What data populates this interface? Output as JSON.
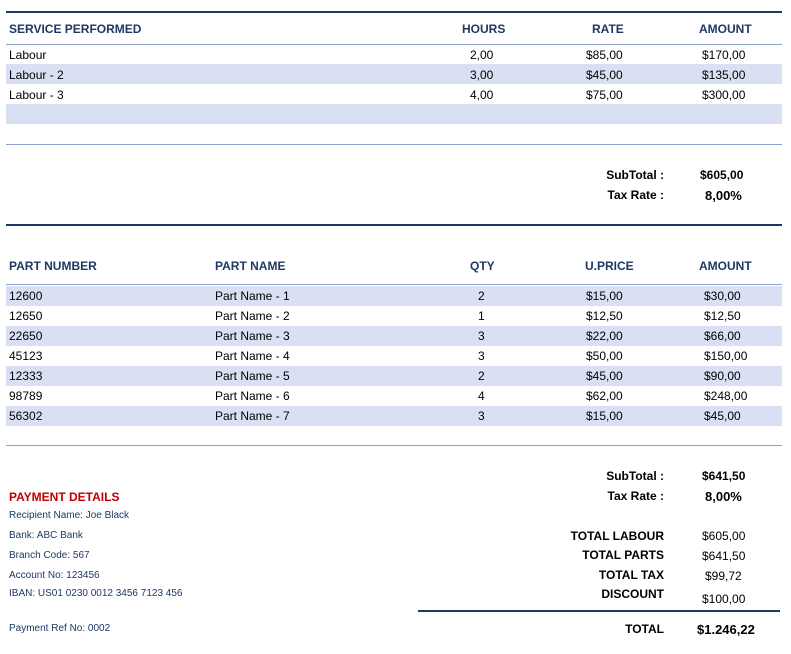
{
  "services": {
    "headers": {
      "service": "SERVICE PERFORMED",
      "hours": "HOURS",
      "rate": "RATE",
      "amount": "AMOUNT"
    },
    "rows": [
      {
        "service": "Labour",
        "hours": "2,00",
        "rate": "$85,00",
        "amount": "$170,00"
      },
      {
        "service": "Labour - 2",
        "hours": "3,00",
        "rate": "$45,00",
        "amount": "$135,00"
      },
      {
        "service": "Labour - 3",
        "hours": "4,00",
        "rate": "$75,00",
        "amount": "$300,00"
      }
    ],
    "subtotal_label": "SubTotal :",
    "subtotal_value": "$605,00",
    "taxrate_label": "Tax Rate :",
    "taxrate_value": "8,00%"
  },
  "parts": {
    "headers": {
      "number": "PART NUMBER",
      "name": "PART NAME",
      "qty": "QTY",
      "uprice": "U.PRICE",
      "amount": "AMOUNT"
    },
    "rows": [
      {
        "number": "12600",
        "name": "Part Name - 1",
        "qty": "2",
        "uprice": "$15,00",
        "amount": "$30,00"
      },
      {
        "number": "12650",
        "name": "Part Name - 2",
        "qty": "1",
        "uprice": "$12,50",
        "amount": "$12,50"
      },
      {
        "number": "22650",
        "name": "Part Name - 3",
        "qty": "3",
        "uprice": "$22,00",
        "amount": "$66,00"
      },
      {
        "number": "45123",
        "name": "Part Name - 4",
        "qty": "3",
        "uprice": "$50,00",
        "amount": "$150,00"
      },
      {
        "number": "12333",
        "name": "Part Name - 5",
        "qty": "2",
        "uprice": "$45,00",
        "amount": "$90,00"
      },
      {
        "number": "98789",
        "name": "Part Name - 6",
        "qty": "4",
        "uprice": "$62,00",
        "amount": "$248,00"
      },
      {
        "number": "56302",
        "name": "Part Name - 7",
        "qty": "3",
        "uprice": "$15,00",
        "amount": "$45,00"
      }
    ],
    "subtotal_label": "SubTotal :",
    "subtotal_value": "$641,50",
    "taxrate_label": "Tax Rate :",
    "taxrate_value": "8,00%"
  },
  "payment": {
    "title": "PAYMENT DETAILS",
    "recipient": "Recipient Name: Joe Black",
    "bank": "Bank: ABC Bank",
    "branch": "Branch Code: 567",
    "account": "Account No: 123456",
    "iban": "IBAN: US01 0230 0012 3456 7123 456",
    "ref": "Payment Ref No: 0002"
  },
  "totals": {
    "labour_label": "TOTAL LABOUR",
    "labour_value": "$605,00",
    "parts_label": "TOTAL PARTS",
    "parts_value": "$641,50",
    "tax_label": "TOTAL TAX",
    "tax_value": "$99,72",
    "discount_label": "DISCOUNT",
    "discount_value": "$100,00",
    "total_label": "TOTAL",
    "total_value": "$1.246,22"
  },
  "colors": {
    "accent": "#1f3864",
    "band": "#d9e0f3",
    "payment_title": "#c00000"
  }
}
